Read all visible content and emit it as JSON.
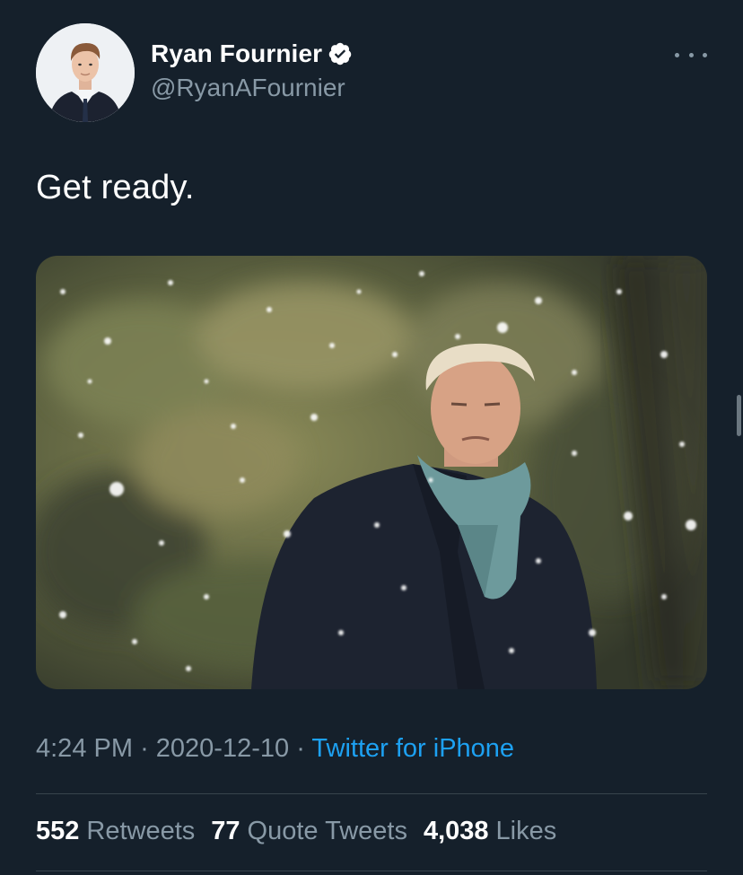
{
  "author": {
    "display_name": "Ryan Fournier",
    "handle": "@RyanAFournier",
    "verified": true
  },
  "tweet": {
    "text": "Get ready.",
    "media_description": "photo"
  },
  "meta": {
    "time": "4:24 PM",
    "separator": "·",
    "date": "2020-12-10",
    "source": "Twitter for iPhone"
  },
  "stats": {
    "retweets_count": "552",
    "retweets_label": "Retweets",
    "quotes_count": "77",
    "quotes_label": "Quote Tweets",
    "likes_count": "4,038",
    "likes_label": "Likes"
  },
  "icons": {
    "verified": "verified-badge-icon",
    "more": "more-horizontal-icon"
  },
  "colors": {
    "background": "#15202b",
    "secondary_text": "#8899a6",
    "link": "#1da1f2",
    "divider": "#38444d"
  }
}
